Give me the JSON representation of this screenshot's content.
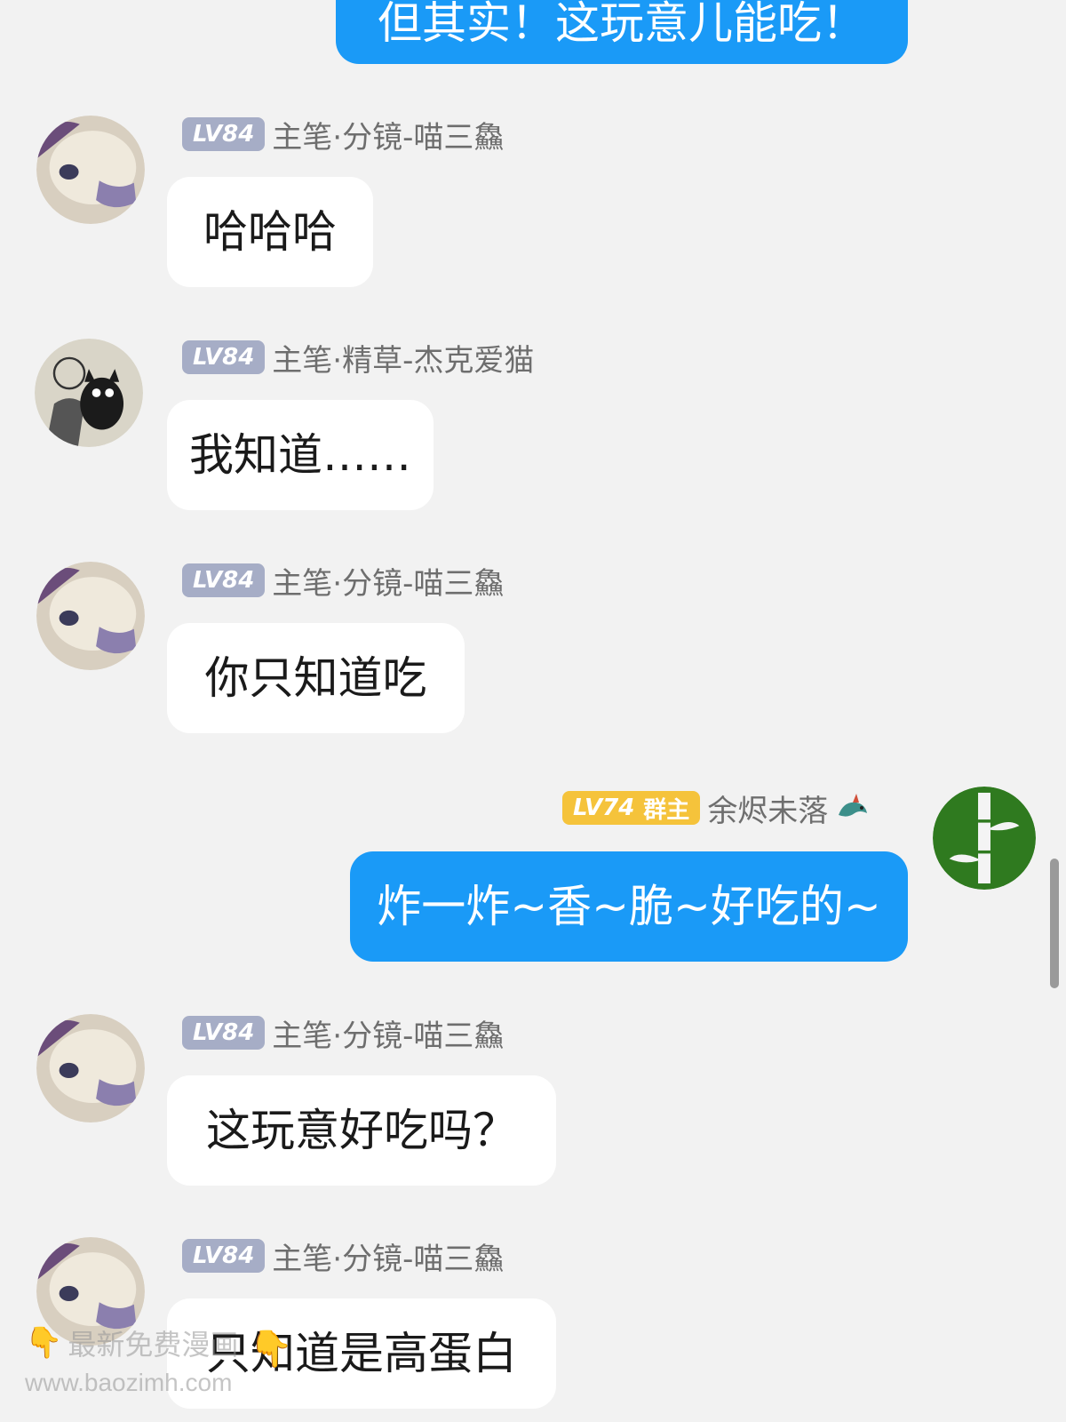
{
  "messages": [
    {
      "side": "out",
      "text": "但其实！这玩意儿能吃！"
    },
    {
      "side": "in",
      "level": "LV84",
      "name": "主笔·分镜-喵三鱻",
      "text": "哈哈哈",
      "avatar_icon": "sea-otter-avatar-icon"
    },
    {
      "side": "in",
      "level": "LV84",
      "name": "主笔·精草-杰克爱猫",
      "text": "我知道……",
      "avatar_icon": "person-with-black-cat-avatar-icon"
    },
    {
      "side": "in",
      "level": "LV84",
      "name": "主笔·分镜-喵三鱻",
      "text": "你只知道吃",
      "avatar_icon": "sea-otter-avatar-icon"
    },
    {
      "side": "out",
      "level": "LV74",
      "badge": "群主",
      "name": "余烬未落",
      "text": "炸一炸~香~脆~好吃的~",
      "avatar_icon": "bamboo-avatar-icon",
      "name_icon": "dragon-icon"
    },
    {
      "side": "in",
      "level": "LV84",
      "name": "主笔·分镜-喵三鱻",
      "text": "这玩意好吃吗？",
      "avatar_icon": "sea-otter-avatar-icon"
    },
    {
      "side": "in",
      "level": "LV84",
      "name": "主笔·分镜-喵三鱻",
      "text": "只知道是高蛋白",
      "avatar_icon": "sea-otter-avatar-icon"
    }
  ],
  "watermark": {
    "line1": "最新免费漫画",
    "line2": "www.baozimh.com",
    "icon": "pointing-down-hand-icon"
  },
  "colors": {
    "background": "#f2f2f2",
    "bubble_out": "#1a9af7",
    "bubble_in": "#ffffff",
    "level_badge": "#a6adc6",
    "owner_badge": "#f5c33b"
  }
}
